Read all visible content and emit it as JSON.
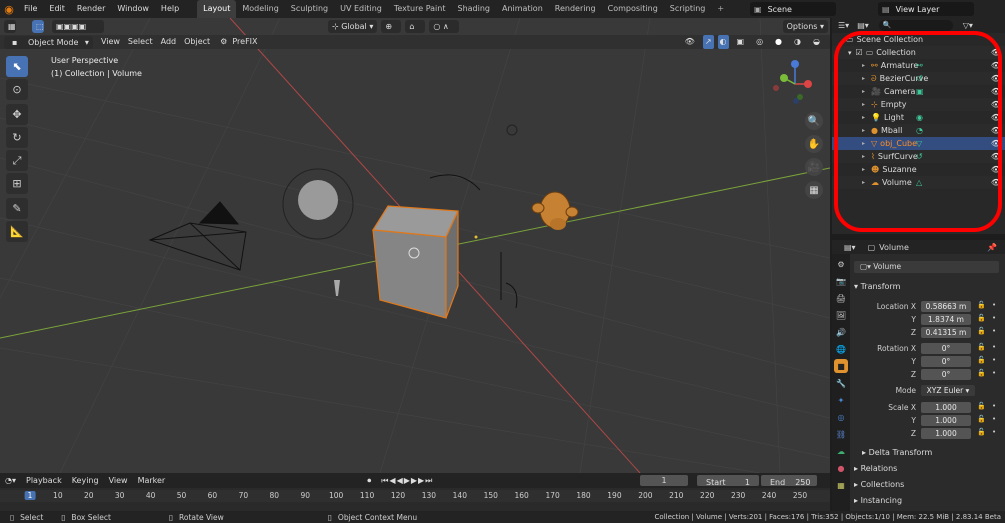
{
  "menubar": [
    "File",
    "Edit",
    "Render",
    "Window",
    "Help"
  ],
  "workspaces": [
    {
      "label": "Layout",
      "active": true
    },
    {
      "label": "Modeling",
      "active": false
    },
    {
      "label": "Sculpting",
      "active": false
    },
    {
      "label": "UV Editing",
      "active": false
    },
    {
      "label": "Texture Paint",
      "active": false
    },
    {
      "label": "Shading",
      "active": false
    },
    {
      "label": "Animation",
      "active": false
    },
    {
      "label": "Rendering",
      "active": false
    },
    {
      "label": "Compositing",
      "active": false
    },
    {
      "label": "Scripting",
      "active": false
    }
  ],
  "scene": "Scene",
  "view_layer": "View Layer",
  "viewport": {
    "mode": "Object Mode",
    "menus": [
      "View",
      "Select",
      "Add",
      "Object"
    ],
    "addon": "PreFIX",
    "transform_orientation": "Global",
    "options": "Options",
    "perspective": "User Perspective",
    "context": "(1) Collection | Volume",
    "gizmo_axes": [
      "X",
      "Y",
      "Z"
    ]
  },
  "outliner": {
    "root": "Scene Collection",
    "collection": "Collection",
    "items": [
      {
        "name": "Armature",
        "color": "#e0922e",
        "selected": false
      },
      {
        "name": "BezierCurve",
        "color": "#e0922e",
        "selected": false
      },
      {
        "name": "Camera",
        "color": "#e0922e",
        "selected": false
      },
      {
        "name": "Empty",
        "color": "#e0922e",
        "selected": false
      },
      {
        "name": "Light",
        "color": "#e0922e",
        "selected": false
      },
      {
        "name": "Mball",
        "color": "#e0922e",
        "selected": false
      },
      {
        "name": "obj_Cube",
        "color": "#ff8f24",
        "selected": true
      },
      {
        "name": "SurfCurve",
        "color": "#e0922e",
        "selected": false
      },
      {
        "name": "Suzanne",
        "color": "#e0922e",
        "selected": false
      },
      {
        "name": "Volume",
        "color": "#e0922e",
        "selected": false
      }
    ]
  },
  "properties": {
    "header": "Volume",
    "object_name": "Volume",
    "transform": "Transform",
    "location_label": "Location X",
    "location": [
      "0.58663 m",
      "1.8374 m",
      "0.41315 m"
    ],
    "rotation_label": "Rotation X",
    "rotation": [
      "0°",
      "0°",
      "0°"
    ],
    "mode_label": "Mode",
    "mode": "XYZ Euler",
    "scale_label": "Scale X",
    "scale": [
      "1.000",
      "1.000",
      "1.000"
    ],
    "axis_y": "Y",
    "axis_z": "Z",
    "sections": [
      "Delta Transform",
      "Relations",
      "Collections",
      "Instancing"
    ]
  },
  "timeline": {
    "menus": [
      "Playback",
      "Keying",
      "View",
      "Marker"
    ],
    "current_frame": "1",
    "start_label": "Start",
    "start": "1",
    "end_label": "End",
    "end": "250",
    "ticks": [
      "1",
      "10",
      "20",
      "30",
      "40",
      "50",
      "60",
      "70",
      "80",
      "90",
      "100",
      "110",
      "120",
      "130",
      "140",
      "150",
      "160",
      "170",
      "180",
      "190",
      "200",
      "210",
      "220",
      "230",
      "240",
      "250"
    ]
  },
  "statusbar": {
    "select": "Select",
    "box_select": "Box Select",
    "rotate_view": "Rotate View",
    "context_menu": "Object Context Menu",
    "stats": "Collection | Volume | Verts:201 | Faces:176 | Tris:352 | Objects:1/10 | Mem: 22.5 MiB | 2.83.14 Beta"
  }
}
